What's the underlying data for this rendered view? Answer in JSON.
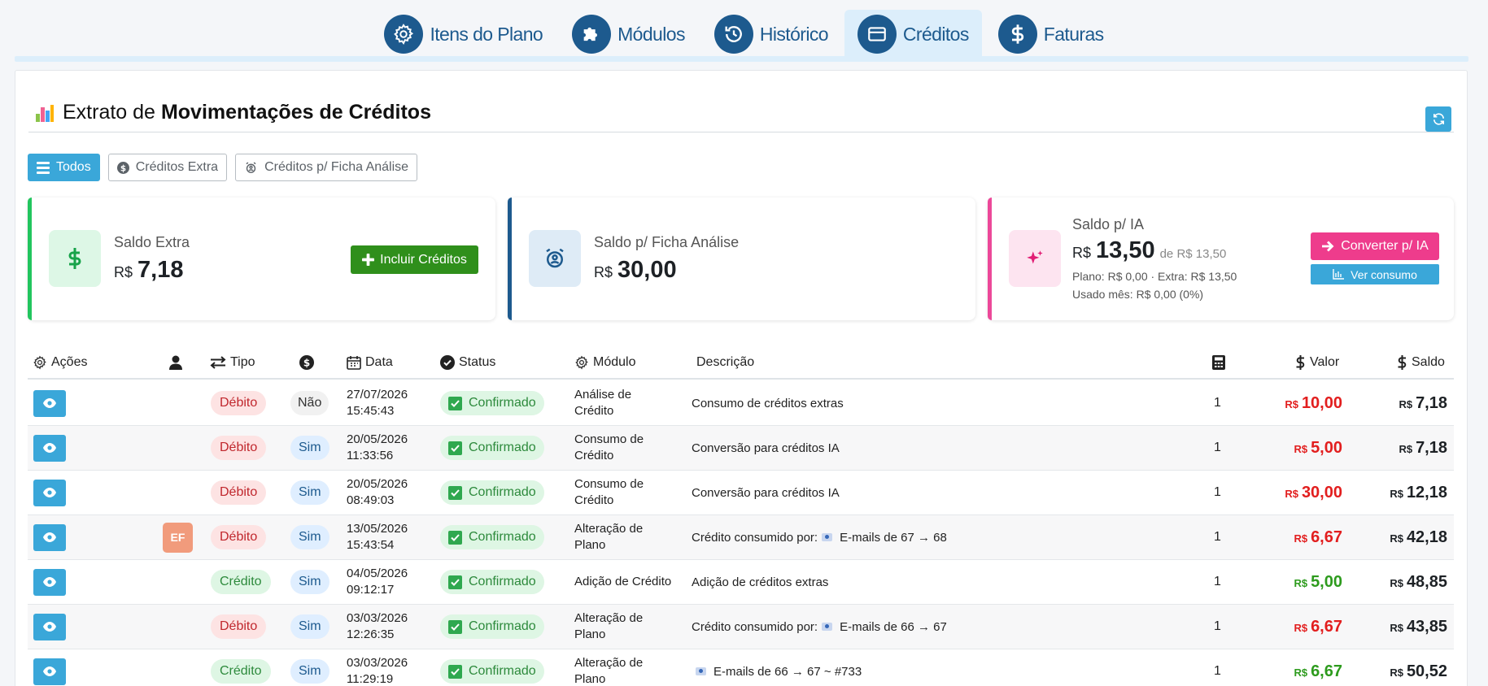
{
  "tabs": [
    {
      "label": "Itens do Plano",
      "icon": "gear-icon",
      "active": false
    },
    {
      "label": "Módulos",
      "icon": "puzzle-icon",
      "active": false
    },
    {
      "label": "Histórico",
      "icon": "history-icon",
      "active": false
    },
    {
      "label": "Créditos",
      "icon": "credit-card-icon",
      "active": true
    },
    {
      "label": "Faturas",
      "icon": "dollar-icon",
      "active": false
    }
  ],
  "page": {
    "title_prefix": "Extrato de",
    "title_bold": "Movimentações de Créditos"
  },
  "filters": [
    {
      "label": "Todos",
      "icon": "list-icon",
      "active": true
    },
    {
      "label": "Créditos Extra",
      "icon": "coin-icon",
      "active": false
    },
    {
      "label": "Créditos p/ Ficha Análise",
      "icon": "user-clock-icon",
      "active": false
    }
  ],
  "cards": {
    "extra": {
      "label": "Saldo Extra",
      "currency": "R$",
      "value": "7,18",
      "button": "Incluir Créditos",
      "color": "#22c55e"
    },
    "ficha": {
      "label": "Saldo p/ Ficha Análise",
      "currency": "R$",
      "value": "30,00",
      "color": "#1d5a8e"
    },
    "ia": {
      "label": "Saldo p/ IA",
      "currency": "R$",
      "value": "13,50",
      "of": "de R$ 13,50",
      "line1": "Plano: R$ 0,00 · Extra: R$ 13,50",
      "line2": "Usado mês: R$ 0,00 (0%)",
      "button_convert": "Converter p/ IA",
      "button_consumo": "Ver consumo",
      "color": "#ec4899"
    }
  },
  "table": {
    "headers": {
      "acoes": "Ações",
      "tipo": "Tipo",
      "data": "Data",
      "status": "Status",
      "modulo": "Módulo",
      "descricao": "Descrição",
      "valor": "Valor",
      "saldo": "Saldo"
    },
    "rows": [
      {
        "user": "",
        "tipo": "Débito",
        "pago": "Não",
        "date": "27/07/2026",
        "time": "15:45:43",
        "status": "Confirmado",
        "mod1": "Análise de",
        "mod2": "Crédito",
        "desc_prefix": "Consumo de créditos extras",
        "desc_flag": false,
        "desc_suffix": "",
        "qty": "1",
        "valor": "10,00",
        "saldo": "7,18"
      },
      {
        "user": "",
        "tipo": "Débito",
        "pago": "Sim",
        "date": "20/05/2026",
        "time": "11:33:56",
        "status": "Confirmado",
        "mod1": "Consumo de",
        "mod2": "Crédito",
        "desc_prefix": "Conversão para créditos IA",
        "desc_flag": false,
        "desc_suffix": "",
        "qty": "1",
        "valor": "5,00",
        "saldo": "7,18"
      },
      {
        "user": "",
        "tipo": "Débito",
        "pago": "Sim",
        "date": "20/05/2026",
        "time": "08:49:03",
        "status": "Confirmado",
        "mod1": "Consumo de",
        "mod2": "Crédito",
        "desc_prefix": "Conversão para créditos IA",
        "desc_flag": false,
        "desc_suffix": "",
        "qty": "1",
        "valor": "30,00",
        "saldo": "12,18"
      },
      {
        "user": "EF",
        "tipo": "Débito",
        "pago": "Sim",
        "date": "13/05/2026",
        "time": "15:43:54",
        "status": "Confirmado",
        "mod1": "Alteração de",
        "mod2": "Plano",
        "desc_prefix": "Crédito consumido por:",
        "desc_flag": true,
        "desc_suffix": "E-mails de 67 → 68",
        "qty": "1",
        "valor": "6,67",
        "saldo": "42,18"
      },
      {
        "user": "",
        "tipo": "Crédito",
        "pago": "Sim",
        "date": "04/05/2026",
        "time": "09:12:17",
        "status": "Confirmado",
        "mod1": "Adição de Crédito",
        "mod2": "",
        "desc_prefix": "Adição de créditos extras",
        "desc_flag": false,
        "desc_suffix": "",
        "qty": "1",
        "valor": "5,00",
        "saldo": "48,85"
      },
      {
        "user": "",
        "tipo": "Débito",
        "pago": "Sim",
        "date": "03/03/2026",
        "time": "12:26:35",
        "status": "Confirmado",
        "mod1": "Alteração de",
        "mod2": "Plano",
        "desc_prefix": "Crédito consumido por:",
        "desc_flag": true,
        "desc_suffix": "E-mails de 66 → 67",
        "qty": "1",
        "valor": "6,67",
        "saldo": "43,85"
      },
      {
        "user": "",
        "tipo": "Crédito",
        "pago": "Sim",
        "date": "03/03/2026",
        "time": "11:29:19",
        "status": "Confirmado",
        "mod1": "Alteração de",
        "mod2": "Plano",
        "desc_prefix": "",
        "desc_flag": true,
        "desc_suffix": "E-mails de 66 → 67 ~ #733",
        "qty": "1",
        "valor": "6,67",
        "saldo": "50,52"
      }
    ]
  },
  "currency": "R$"
}
